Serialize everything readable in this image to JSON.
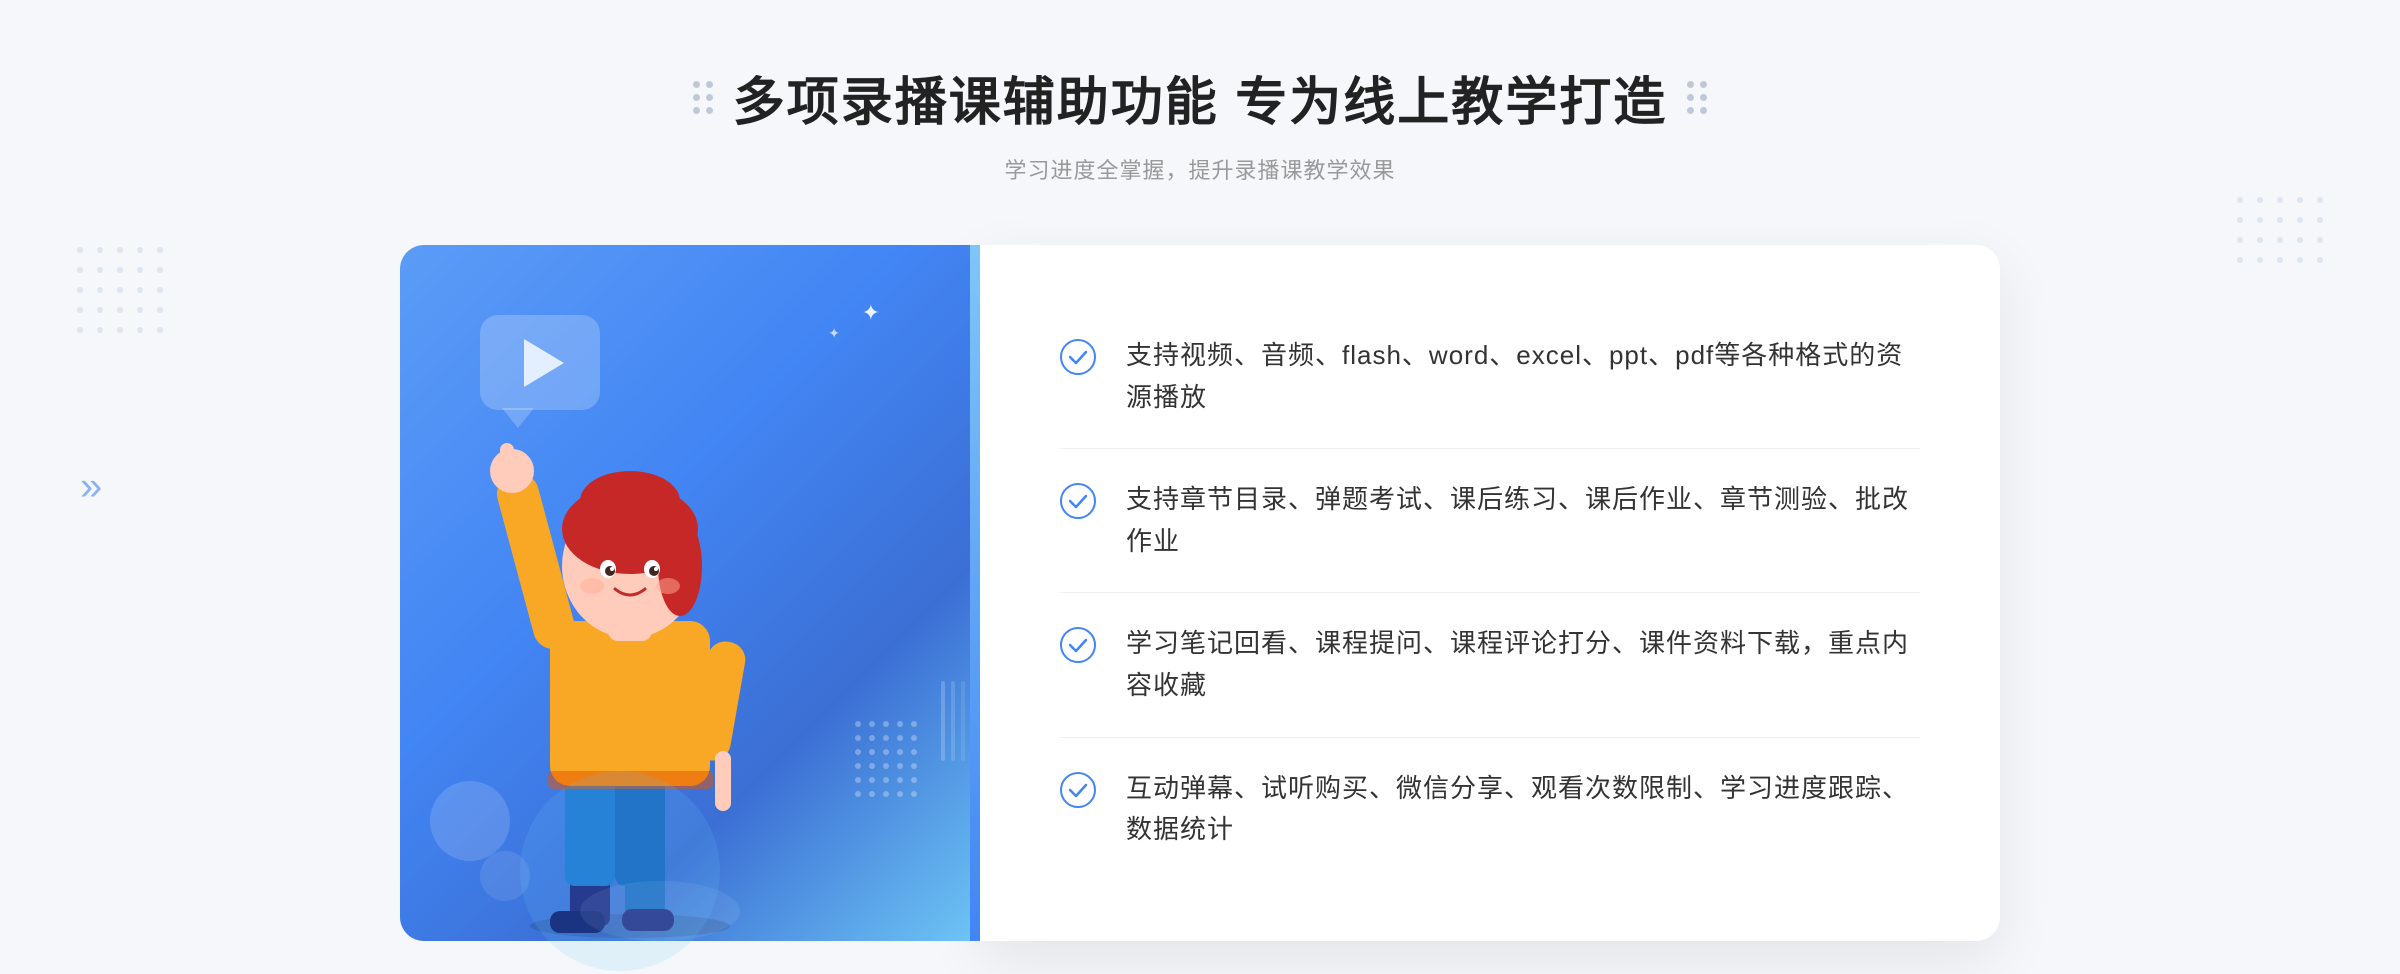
{
  "header": {
    "title": "多项录播课辅助功能 专为线上教学打造",
    "subtitle": "学习进度全掌握，提升录播课教学效果",
    "title_left_dec": "decoration",
    "title_right_dec": "decoration"
  },
  "features": [
    {
      "id": 1,
      "text": "支持视频、音频、flash、word、excel、ppt、pdf等各种格式的资源播放"
    },
    {
      "id": 2,
      "text": "支持章节目录、弹题考试、课后练习、课后作业、章节测验、批改作业"
    },
    {
      "id": 3,
      "text": "学习笔记回看、课程提问、课程评论打分、课件资料下载，重点内容收藏"
    },
    {
      "id": 4,
      "text": "互动弹幕、试听购买、微信分享、观看次数限制、学习进度跟踪、数据统计"
    }
  ],
  "colors": {
    "primary": "#4285f4",
    "primary_light": "#6ec6f5",
    "primary_dark": "#3b6fd4",
    "text_dark": "#222222",
    "text_medium": "#333333",
    "text_light": "#999999",
    "bg": "#f5f7fa",
    "white": "#ffffff",
    "check_color": "#4285f4"
  },
  "icons": {
    "check": "check-circle-icon",
    "play": "play-icon",
    "left_arrows": "«"
  }
}
